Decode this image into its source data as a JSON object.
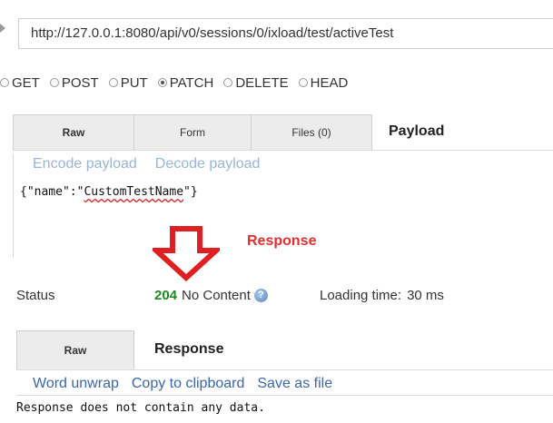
{
  "request": {
    "url": "http://127.0.0.1:8080/api/v0/sessions/0/ixload/test/activeTest",
    "methods": [
      {
        "label": "GET",
        "checked": false
      },
      {
        "label": "POST",
        "checked": false
      },
      {
        "label": "PUT",
        "checked": false
      },
      {
        "label": "PATCH",
        "checked": true
      },
      {
        "label": "DELETE",
        "checked": false
      },
      {
        "label": "HEAD",
        "checked": false
      }
    ],
    "tabs": {
      "raw": "Raw",
      "form": "Form",
      "files": "Files (0)",
      "payload": "Payload"
    },
    "encode_payload": "Encode payload",
    "decode_payload": "Decode payload",
    "payload_prefix": "{\"name\":\"",
    "payload_value": "CustomTestName",
    "payload_suffix": "\"}"
  },
  "annotation": {
    "label": "Response",
    "color": "#e03030"
  },
  "status": {
    "label": "Status",
    "code": "204",
    "text": "No Content",
    "code_color": "#1e8a1e",
    "loading_label": "Loading time:",
    "loading_value": "30 ms"
  },
  "response": {
    "tabs": {
      "raw": "Raw",
      "title": "Response"
    },
    "links": {
      "word_unwrap": "Word unwrap",
      "copy": "Copy to clipboard",
      "save": "Save as file"
    },
    "body": "Response does not contain any data."
  }
}
